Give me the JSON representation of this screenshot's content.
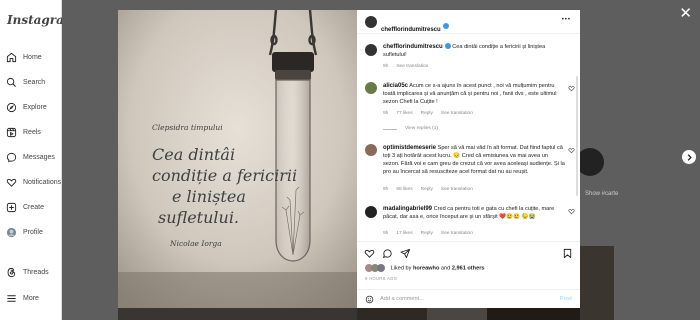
{
  "app": {
    "logo": "Instagram"
  },
  "sidebar": {
    "items": [
      {
        "label": "Home",
        "icon": "home-icon"
      },
      {
        "label": "Search",
        "icon": "search-icon"
      },
      {
        "label": "Explore",
        "icon": "compass-icon"
      },
      {
        "label": "Reels",
        "icon": "reels-icon"
      },
      {
        "label": "Messages",
        "icon": "messenger-icon"
      },
      {
        "label": "Notifications",
        "icon": "heart-icon"
      },
      {
        "label": "Create",
        "icon": "plus-square-icon"
      },
      {
        "label": "Profile",
        "icon": "avatar"
      },
      {
        "label": "Threads",
        "icon": "threads-icon"
      },
      {
        "label": "More",
        "icon": "menu-icon"
      }
    ]
  },
  "background": {
    "suggestion_label": "Show #carte"
  },
  "modal": {
    "close_glyph": "✕",
    "image_quote": {
      "header": "Clepsidra timpului",
      "line1": "Cea dintâi",
      "line2": "condiție a fericirii",
      "line3": "e liniștea",
      "line4": "sufletului.",
      "author": "Nicolae Iorga"
    },
    "post": {
      "username": "chefflorindumitrescu",
      "more_glyph": "•••",
      "caption_user": "chefflorindumitrescu",
      "caption": "Cea dintâi condiție a fericirii și liniștea sufletului!",
      "caption_time": "9h",
      "see_translation": "See translation"
    },
    "comments": [
      {
        "user": "alicia05c",
        "text": "Acum ce s-a ajuns în acest punct , noi vă mulțumim pentru toată implicarea și vă anunțăm că și pentru noi , fanii dvs , este ultimul sezon Chefi la Cuțite !",
        "time": "9h",
        "likes": "77 likes",
        "reply": "Reply",
        "translate": "See translation",
        "view_replies": "View replies (1)"
      },
      {
        "user": "optimistdemeserie",
        "text": "Sper să vă mai văd în alt format. Dat fiind faptul că toți 3 ați hotărât acest lucru. 😔 Cred că emisiunea va mai avea un sezon. Fără voi e cam greu de crezut că vor avea aceleași audiențe. Și la pro au încercat să resusciteze acel format dat nu au reușit.",
        "time": "9h",
        "likes": "68 likes",
        "reply": "Reply",
        "translate": "See translation"
      },
      {
        "user": "madalingabriel99",
        "text": "Cred ca pentru toti e gata cu chefi la cuțite, mare păcat, dar asa e, orice început are și un sfârșit ❤️😢😢 😓😭",
        "time": "9h",
        "likes": "17 likes",
        "reply": "Reply",
        "translate": "See translation"
      }
    ],
    "liked_by_prefix": "Liked by ",
    "liked_by_user": "horeawho",
    "liked_by_and": " and ",
    "liked_by_count": "2,961 others",
    "timestamp": "9 HOURS AGO",
    "add_comment_placeholder": "Add a comment...",
    "post_button": "Post"
  },
  "colors": {
    "accent": "#0095f6",
    "like_red": "#ed4956",
    "overlay": "#000000"
  }
}
